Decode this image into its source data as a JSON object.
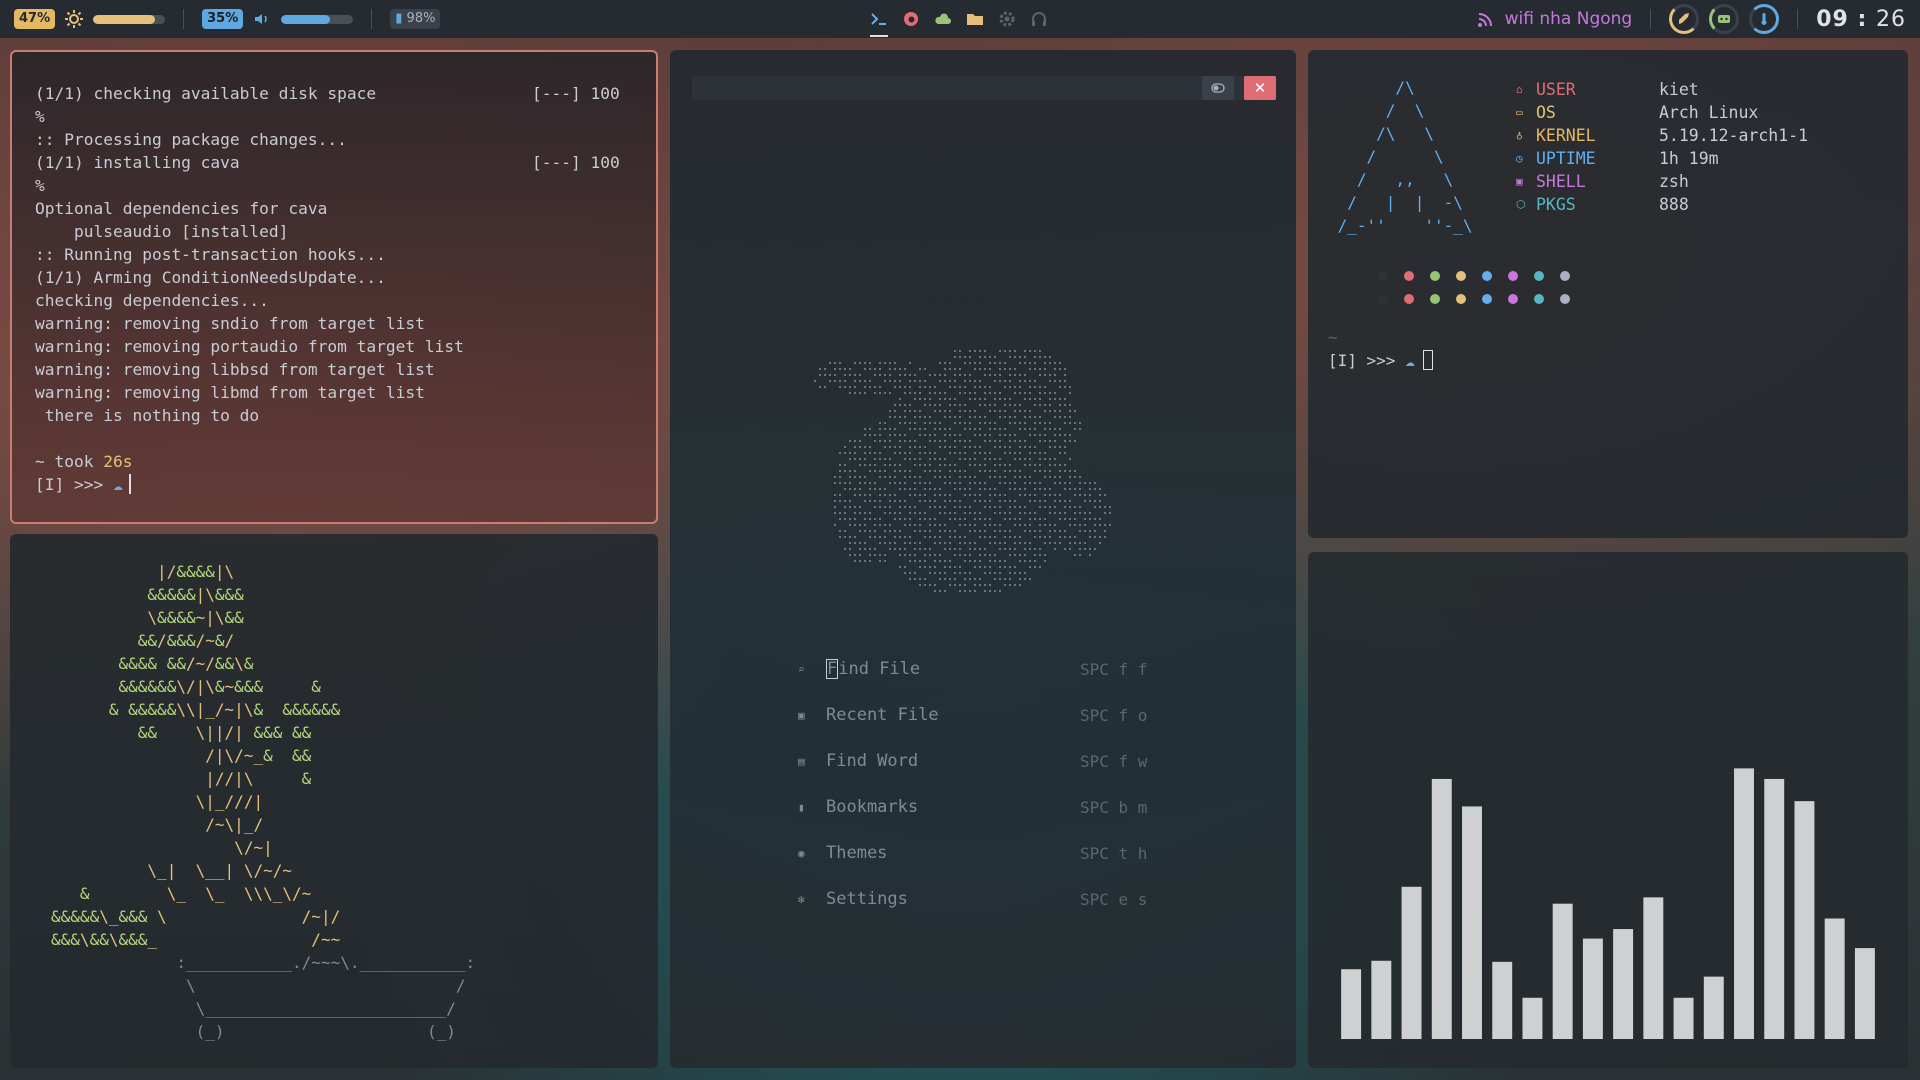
{
  "topbar": {
    "battery_label": "47%",
    "brightness_value": 0.86,
    "volume_label": "35%",
    "volume_value": 0.68,
    "disk_label": "98%",
    "wifi_name": "wifi nha Ngong",
    "clock_hours": "09",
    "clock_sep": ":",
    "clock_minutes": "26",
    "workspace_icons": [
      "terminal-icon",
      "firefox-icon",
      "cloud-icon",
      "folder-icon",
      "gear-icon",
      "headphones-icon"
    ],
    "accent_yellow": "#e5b862",
    "accent_blue": "#5fa8e0",
    "accent_purple": "#c678dd"
  },
  "terminal": {
    "lines": [
      "(1/1) checking available disk space                [---] 100",
      "%",
      ":: Processing package changes...",
      "(1/1) installing cava                              [---] 100",
      "%",
      "Optional dependencies for cava",
      "    pulseaudio [installed]",
      ":: Running post-transaction hooks...",
      "(1/1) Arming ConditionNeedsUpdate...",
      "checking dependencies...",
      "warning: removing sndio from target list",
      "warning: removing portaudio from target list",
      "warning: removing libbsd from target list",
      "warning: removing libmd from target list",
      " there is nothing to do",
      ""
    ],
    "took_prefix": "~ took ",
    "took_time": "26s",
    "prompt": "[I] >>> ",
    "prompt_icon": "☁"
  },
  "bonsai": {
    "lines": [
      "           |/&&&&|\\",
      "          &&&&&|\\&&&",
      "          \\&&&&~|\\&&",
      "         &&/&&&/~&/",
      "       &&&& &&/~/&&\\&",
      "       &&&&&&\\/|\\&~&&&     &",
      "      & &&&&&\\\\|_/~|\\&  &&&&&&",
      "         &&    \\||/| &&& &&",
      "                /|\\/~_&  &&",
      "                |//|\\     &",
      "               \\|_///|",
      "                /~\\|_/",
      "                   \\/~|",
      "          \\_|  \\__| \\/~/~",
      "   &        \\_  \\_  \\\\\\_\\/~",
      "&&&&&\\_&&& \\              /~|/",
      "&&&\\&&\\&&&_                /~~",
      "             :___________./~~~\\.___________:",
      "              \\                           /",
      "               \\_________________________/",
      "               (_)                     (_)"
    ]
  },
  "editor": {
    "menu": [
      {
        "icon": "search-icon",
        "label": "Find File",
        "key": "SPC f f"
      },
      {
        "icon": "recent-file-icon",
        "label": "Recent File",
        "key": "SPC f o"
      },
      {
        "icon": "find-word-icon",
        "label": "Find Word",
        "key": "SPC f w"
      },
      {
        "icon": "bookmark-icon",
        "label": "Bookmarks",
        "key": "SPC b m"
      },
      {
        "icon": "palette-icon",
        "label": "Themes",
        "key": "SPC t h"
      },
      {
        "icon": "settings-icon",
        "label": "Settings",
        "key": "SPC e s"
      }
    ]
  },
  "fetch": {
    "logo_lines": [
      "       /\\",
      "      /  \\",
      "     /\\   \\",
      "    /      \\",
      "   /   ,,   \\",
      "  /   |  |  -\\",
      " /_-''    ''-_\\"
    ],
    "rows": [
      {
        "key": "USER",
        "value": "kiet",
        "color": "#e06c75"
      },
      {
        "key": "OS",
        "value": "Arch Linux",
        "color": "#e5c07b"
      },
      {
        "key": "KERNEL",
        "value": "5.19.12-arch1-1",
        "color": "#e5b862"
      },
      {
        "key": "UPTIME",
        "value": "1h 19m",
        "color": "#61afef"
      },
      {
        "key": "SHELL",
        "value": "zsh",
        "color": "#c678dd"
      },
      {
        "key": "PKGS",
        "value": "888",
        "color": "#56b6c2"
      }
    ],
    "palette": [
      "#2c3238",
      "#e06c75",
      "#98c379",
      "#e5c07b",
      "#61afef",
      "#c678dd",
      "#56b6c2",
      "#abb2bf"
    ],
    "prompt_tilde": "~",
    "prompt": "[I] >>> ",
    "prompt_icon": "☁"
  },
  "chart_data": {
    "type": "bar",
    "values": [
      66,
      74,
      144,
      246,
      220,
      73,
      39,
      128,
      95,
      104,
      134,
      39,
      59,
      256,
      246,
      225,
      114,
      86
    ],
    "ylim": [
      0,
      280
    ],
    "bar_color": "#cfd0d1"
  }
}
